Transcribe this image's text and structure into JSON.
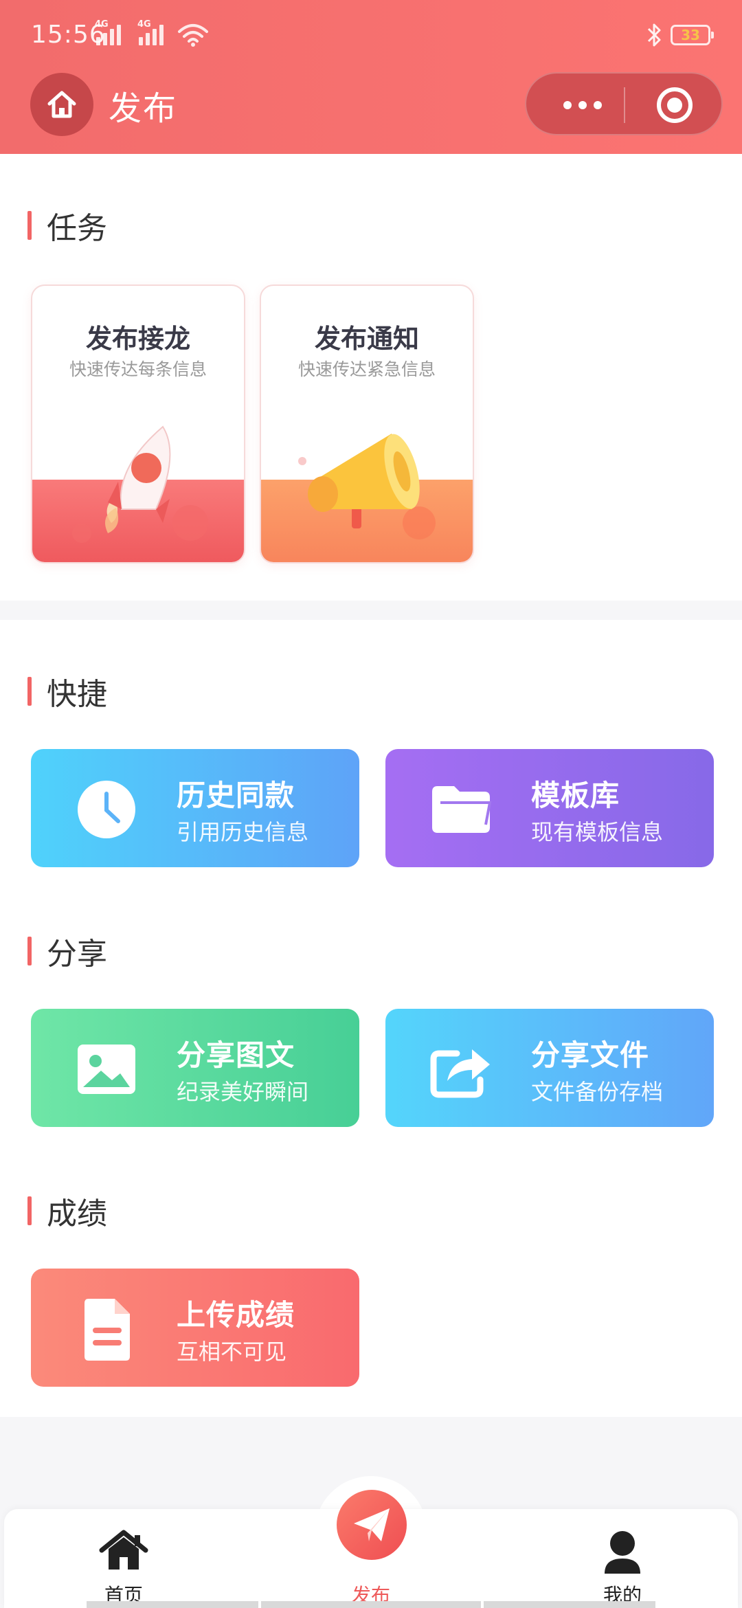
{
  "status_bar": {
    "time": "15:56",
    "network_1": "4G",
    "network_2": "4G",
    "battery": "33"
  },
  "header": {
    "title": "发布"
  },
  "sections": {
    "task": {
      "title": "任务",
      "cards": [
        {
          "title": "发布接龙",
          "subtitle": "快速传达每条信息"
        },
        {
          "title": "发布通知",
          "subtitle": "快速传达紧急信息"
        }
      ]
    },
    "quick": {
      "title": "快捷",
      "cards": [
        {
          "title": "历史同款",
          "subtitle": "引用历史信息"
        },
        {
          "title": "模板库",
          "subtitle": "现有模板信息"
        }
      ]
    },
    "share": {
      "title": "分享",
      "cards": [
        {
          "title": "分享图文",
          "subtitle": "纪录美好瞬间"
        },
        {
          "title": "分享文件",
          "subtitle": "文件备份存档"
        }
      ]
    },
    "score": {
      "title": "成绩",
      "cards": [
        {
          "title": "上传成绩",
          "subtitle": "互相不可见"
        }
      ]
    }
  },
  "tabbar": {
    "items": [
      {
        "label": "首页"
      },
      {
        "label": "发布"
      },
      {
        "label": "我的"
      }
    ]
  },
  "colors": {
    "brand": "#f26c6c",
    "accent_red": "#ee5a5a"
  }
}
